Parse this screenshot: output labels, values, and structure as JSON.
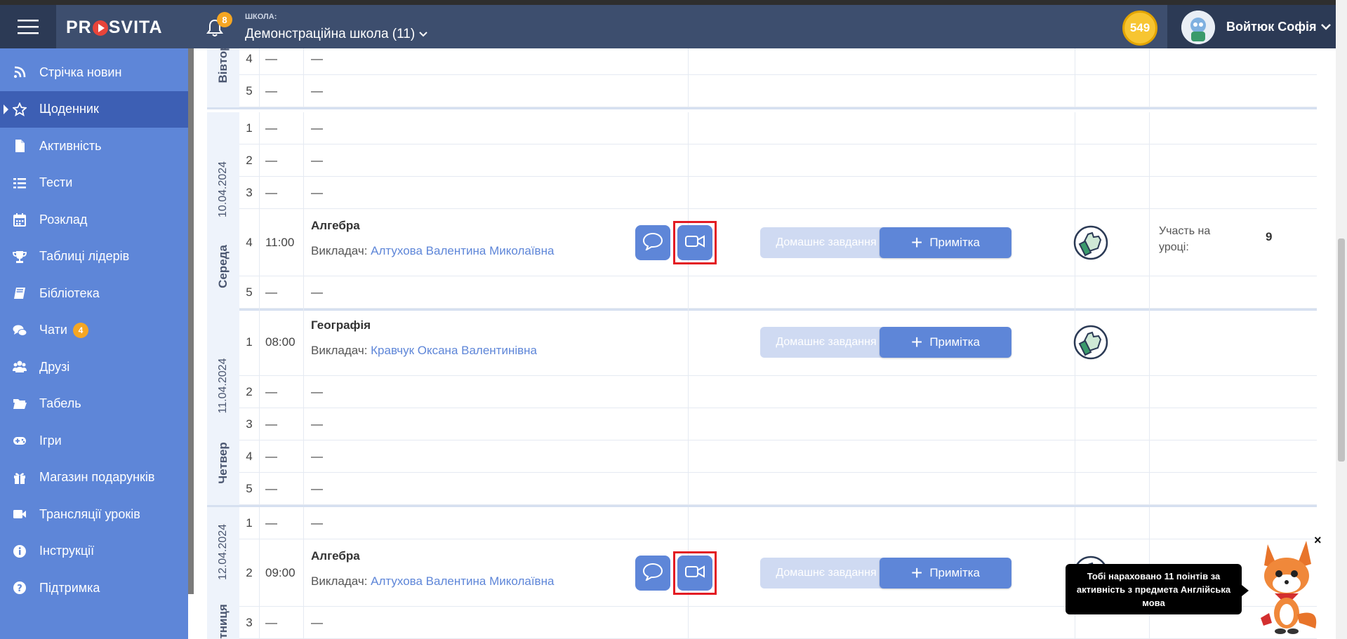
{
  "header": {
    "logo": "PROSVITA",
    "notifications_count": "8",
    "school_label": "ШКОЛА:",
    "school_name": "Демонстраційна школа (11)",
    "points": "549",
    "user_name": "Войтюк Софія"
  },
  "sidebar": {
    "items": [
      {
        "label": "Стрічка новин",
        "icon": "rss-icon"
      },
      {
        "label": "Щоденник",
        "icon": "star-icon",
        "active": true
      },
      {
        "label": "Активність",
        "icon": "file-icon"
      },
      {
        "label": "Тести",
        "icon": "list-icon"
      },
      {
        "label": "Розклад",
        "icon": "calendar-icon"
      },
      {
        "label": "Таблиці лідерів",
        "icon": "trophy-icon"
      },
      {
        "label": "Бібліотека",
        "icon": "book-icon"
      },
      {
        "label": "Чати",
        "icon": "chat-icon",
        "badge": "4"
      },
      {
        "label": "Друзі",
        "icon": "users-icon"
      },
      {
        "label": "Табель",
        "icon": "folder-icon"
      },
      {
        "label": "Ігри",
        "icon": "gamepad-icon"
      },
      {
        "label": "Магазин подарунків",
        "icon": "gift-icon"
      },
      {
        "label": "Трансляції уроків",
        "icon": "video-icon"
      },
      {
        "label": "Інструкції",
        "icon": "info-icon"
      },
      {
        "label": "Підтримка",
        "icon": "help-icon"
      }
    ]
  },
  "schedule": {
    "dash": "—",
    "teacher_prefix": "Викладач:",
    "homework_label": "Домашнє завдання",
    "note_label": "Примітка",
    "participation_label": "Участь на уроці:",
    "days": [
      {
        "name": "Вівторок",
        "date": "",
        "rows": [
          {
            "num": "4",
            "time": "—",
            "subject": "—"
          },
          {
            "num": "5",
            "time": "—",
            "subject": "—"
          }
        ]
      },
      {
        "name": "Середа",
        "date": "10.04.2024",
        "rows": [
          {
            "num": "1",
            "time": "—",
            "subject": "—"
          },
          {
            "num": "2",
            "time": "—",
            "subject": "—"
          },
          {
            "num": "3",
            "time": "—",
            "subject": "—"
          },
          {
            "num": "4",
            "time": "11:00",
            "subject": "Алгебра",
            "teacher": "Алтухова Валентина Миколаївна",
            "participation": "9"
          },
          {
            "num": "5",
            "time": "—",
            "subject": "—"
          }
        ]
      },
      {
        "name": "Четвер",
        "date": "11.04.2024",
        "rows": [
          {
            "num": "1",
            "time": "08:00",
            "subject": "Географія",
            "teacher": "Кравчук Оксана Валентинівна"
          },
          {
            "num": "2",
            "time": "—",
            "subject": "—"
          },
          {
            "num": "3",
            "time": "—",
            "subject": "—"
          },
          {
            "num": "4",
            "time": "—",
            "subject": "—"
          },
          {
            "num": "5",
            "time": "—",
            "subject": "—"
          }
        ]
      },
      {
        "name": "П'ятниця",
        "date": "12.04.2024",
        "rows": [
          {
            "num": "1",
            "time": "—",
            "subject": "—"
          },
          {
            "num": "2",
            "time": "09:00",
            "subject": "Алгебра",
            "teacher": "Алтухова Валентина Миколаївна"
          },
          {
            "num": "3",
            "time": "—",
            "subject": "—"
          }
        ]
      }
    ]
  },
  "toast": {
    "message": "Тобі нараховано 11 поінтів за активність з предмета Англійська мова",
    "close": "×"
  },
  "colors": {
    "sidebar": "#5e86d8",
    "sidebar_active": "#3d5fb4",
    "header": "#3d4e6e",
    "accent": "#5e86d8",
    "highlight": "#e31b23",
    "badge": "#f5a623"
  }
}
